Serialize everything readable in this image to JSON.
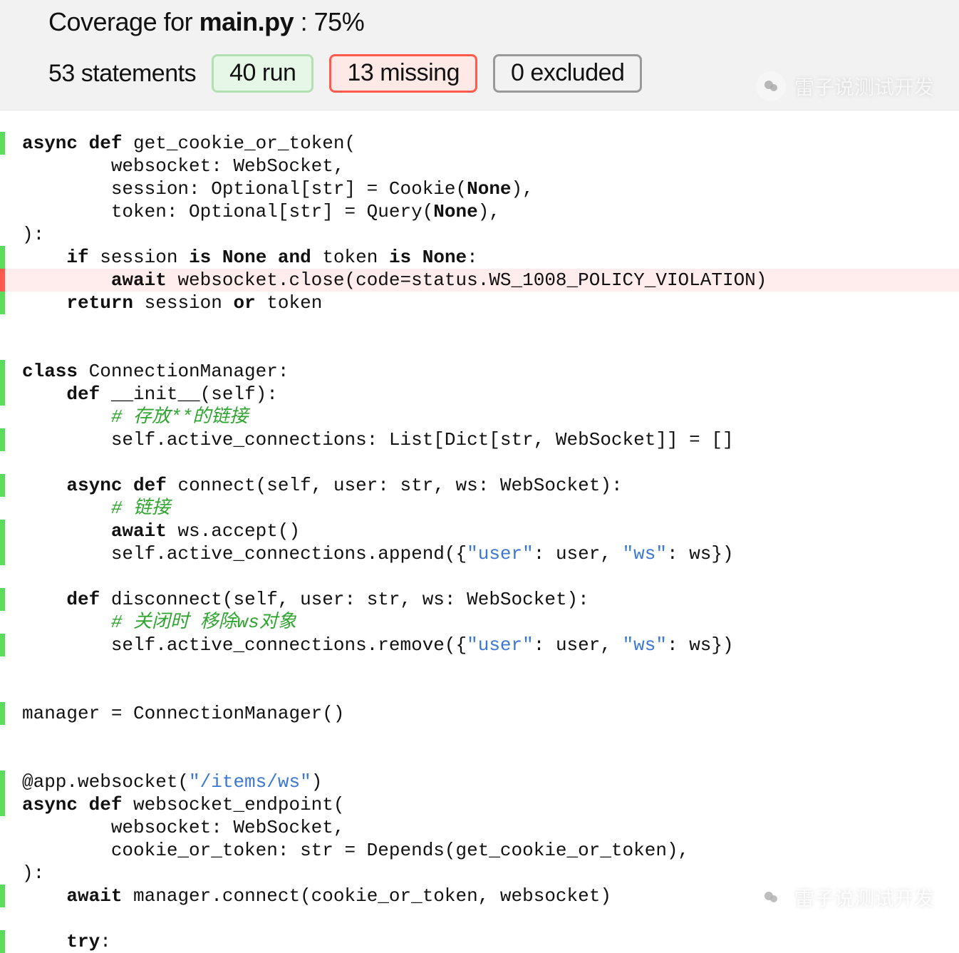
{
  "header": {
    "coverage_for_label": "Coverage for ",
    "filename": "main.py",
    "percent_label": " : 75%",
    "statements": "53 statements",
    "run": "40 run",
    "missing": "13 missing",
    "excluded": "0 excluded"
  },
  "watermark": {
    "text": "雷子说测试开发",
    "icon": "wechat-icon"
  },
  "code": {
    "lines": [
      {
        "cov": "run",
        "segs": [
          [
            "kw",
            "async def"
          ],
          [
            "",
            " get_cookie_or_token("
          ]
        ]
      },
      {
        "cov": "",
        "segs": [
          [
            "",
            "        websocket: WebSocket,"
          ]
        ]
      },
      {
        "cov": "",
        "segs": [
          [
            "",
            "        session: Optional[str] = Cookie("
          ],
          [
            "kw",
            "None"
          ],
          [
            "",
            "),"
          ]
        ]
      },
      {
        "cov": "",
        "segs": [
          [
            "",
            "        token: Optional[str] = Query("
          ],
          [
            "kw",
            "None"
          ],
          [
            "",
            "),"
          ]
        ]
      },
      {
        "cov": "",
        "segs": [
          [
            "",
            "):"
          ]
        ]
      },
      {
        "cov": "run",
        "segs": [
          [
            "",
            "    "
          ],
          [
            "kw",
            "if"
          ],
          [
            "",
            " session "
          ],
          [
            "kw",
            "is None and"
          ],
          [
            "",
            " token "
          ],
          [
            "kw",
            "is None"
          ],
          [
            "",
            ":"
          ]
        ]
      },
      {
        "cov": "miss",
        "segs": [
          [
            "",
            "        "
          ],
          [
            "kw",
            "await"
          ],
          [
            "",
            " websocket.close(code=status.WS_1008_POLICY_VIOLATION)"
          ]
        ]
      },
      {
        "cov": "run",
        "segs": [
          [
            "",
            "    "
          ],
          [
            "kw",
            "return"
          ],
          [
            "",
            " session "
          ],
          [
            "kw",
            "or"
          ],
          [
            "",
            " token"
          ]
        ]
      },
      {
        "cov": "",
        "segs": [
          [
            "",
            ""
          ]
        ]
      },
      {
        "cov": "",
        "segs": [
          [
            "",
            ""
          ]
        ]
      },
      {
        "cov": "run",
        "segs": [
          [
            "kw",
            "class"
          ],
          [
            "",
            " ConnectionManager:"
          ]
        ]
      },
      {
        "cov": "run",
        "segs": [
          [
            "",
            "    "
          ],
          [
            "kw",
            "def"
          ],
          [
            "",
            " __init__(self):"
          ]
        ]
      },
      {
        "cov": "",
        "segs": [
          [
            "",
            "        "
          ],
          [
            "com",
            "# 存放**的链接"
          ]
        ]
      },
      {
        "cov": "run",
        "segs": [
          [
            "",
            "        self.active_connections: List[Dict[str, WebSocket]] = []"
          ]
        ]
      },
      {
        "cov": "",
        "segs": [
          [
            "",
            ""
          ]
        ]
      },
      {
        "cov": "run",
        "segs": [
          [
            "",
            "    "
          ],
          [
            "kw",
            "async def"
          ],
          [
            "",
            " connect(self, user: str, ws: WebSocket):"
          ]
        ]
      },
      {
        "cov": "",
        "segs": [
          [
            "",
            "        "
          ],
          [
            "com",
            "# 链接"
          ]
        ]
      },
      {
        "cov": "run",
        "segs": [
          [
            "",
            "        "
          ],
          [
            "kw",
            "await"
          ],
          [
            "",
            " ws.accept()"
          ]
        ]
      },
      {
        "cov": "run",
        "segs": [
          [
            "",
            "        self.active_connections.append({"
          ],
          [
            "str",
            "\"user\""
          ],
          [
            "",
            ": user, "
          ],
          [
            "str",
            "\"ws\""
          ],
          [
            "",
            ": ws})"
          ]
        ]
      },
      {
        "cov": "",
        "segs": [
          [
            "",
            ""
          ]
        ]
      },
      {
        "cov": "run",
        "segs": [
          [
            "",
            "    "
          ],
          [
            "kw",
            "def"
          ],
          [
            "",
            " disconnect(self, user: str, ws: WebSocket):"
          ]
        ]
      },
      {
        "cov": "",
        "segs": [
          [
            "",
            "        "
          ],
          [
            "com",
            "# 关闭时 移除ws对象"
          ]
        ]
      },
      {
        "cov": "run",
        "segs": [
          [
            "",
            "        self.active_connections.remove({"
          ],
          [
            "str",
            "\"user\""
          ],
          [
            "",
            ": user, "
          ],
          [
            "str",
            "\"ws\""
          ],
          [
            "",
            ": ws})"
          ]
        ]
      },
      {
        "cov": "",
        "segs": [
          [
            "",
            ""
          ]
        ]
      },
      {
        "cov": "",
        "segs": [
          [
            "",
            ""
          ]
        ]
      },
      {
        "cov": "run",
        "segs": [
          [
            "",
            "manager = ConnectionManager()"
          ]
        ]
      },
      {
        "cov": "",
        "segs": [
          [
            "",
            ""
          ]
        ]
      },
      {
        "cov": "",
        "segs": [
          [
            "",
            ""
          ]
        ]
      },
      {
        "cov": "run",
        "segs": [
          [
            "",
            "@app.websocket("
          ],
          [
            "str",
            "\"/items/ws\""
          ],
          [
            "",
            ")"
          ]
        ]
      },
      {
        "cov": "run",
        "segs": [
          [
            "kw",
            "async def"
          ],
          [
            "",
            " websocket_endpoint("
          ]
        ]
      },
      {
        "cov": "",
        "segs": [
          [
            "",
            "        websocket: WebSocket,"
          ]
        ]
      },
      {
        "cov": "",
        "segs": [
          [
            "",
            "        cookie_or_token: str = Depends(get_cookie_or_token),"
          ]
        ]
      },
      {
        "cov": "",
        "segs": [
          [
            "",
            "):"
          ]
        ]
      },
      {
        "cov": "run",
        "segs": [
          [
            "",
            "    "
          ],
          [
            "kw",
            "await"
          ],
          [
            "",
            " manager.connect(cookie_or_token, websocket)"
          ]
        ]
      },
      {
        "cov": "",
        "segs": [
          [
            "",
            ""
          ]
        ]
      },
      {
        "cov": "run",
        "segs": [
          [
            "",
            "    "
          ],
          [
            "kw",
            "try"
          ],
          [
            "",
            ":"
          ]
        ]
      }
    ]
  }
}
